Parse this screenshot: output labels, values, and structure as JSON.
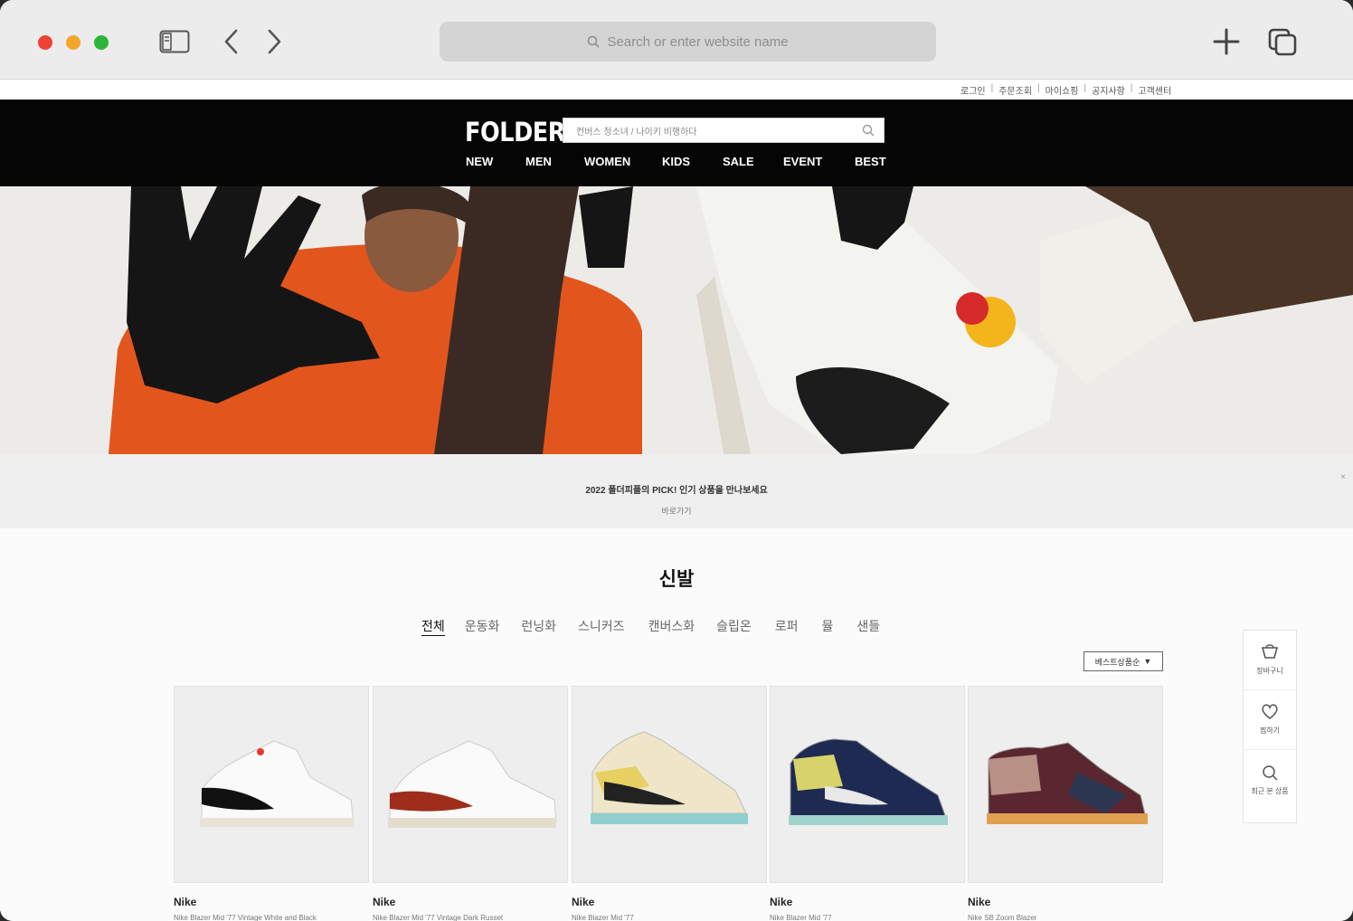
{
  "browser": {
    "address_placeholder": "Search or enter website name"
  },
  "site": {
    "util_links": [
      "로그인",
      "주문조회",
      "마이쇼핑",
      "공지사항",
      "고객센터"
    ],
    "logo": "FOLDER",
    "search_placeholder": "컨버스 청소녀 / 나이키 비행하다",
    "nav": [
      "NEW",
      "MEN",
      "WOMEN",
      "KIDS",
      "SALE",
      "EVENT",
      "BEST"
    ]
  },
  "banner": {
    "main": "2022 폴더피플의 PICK! 인기 상품을 만나보세요",
    "sub": "바로가기",
    "close": "×"
  },
  "section": {
    "title": "신발",
    "categories": [
      "전체",
      "운동화",
      "런닝화",
      "스니커즈",
      "캔버스화",
      "슬립온",
      "로퍼",
      "뮬",
      "샌들"
    ],
    "sort": "베스트상품순"
  },
  "products": [
    {
      "brand": "Nike",
      "name": "Nike Blazer Mid '77 Vintage White and Black"
    },
    {
      "brand": "Nike",
      "name": "Nike Blazer Mid '77 Vintage Dark Russet"
    },
    {
      "brand": "Nike",
      "name": "Nike Blazer Mid '77"
    },
    {
      "brand": "Nike",
      "name": "Nike Blazer Mid '77"
    },
    {
      "brand": "Nike",
      "name": "Nike SB Zoom Blazer"
    }
  ],
  "quick_menu": [
    {
      "icon": "basket-icon",
      "label": "장바구니"
    },
    {
      "icon": "heart-icon",
      "label": "찜하기"
    },
    {
      "icon": "search-icon",
      "label": "최근 본 상품"
    }
  ]
}
